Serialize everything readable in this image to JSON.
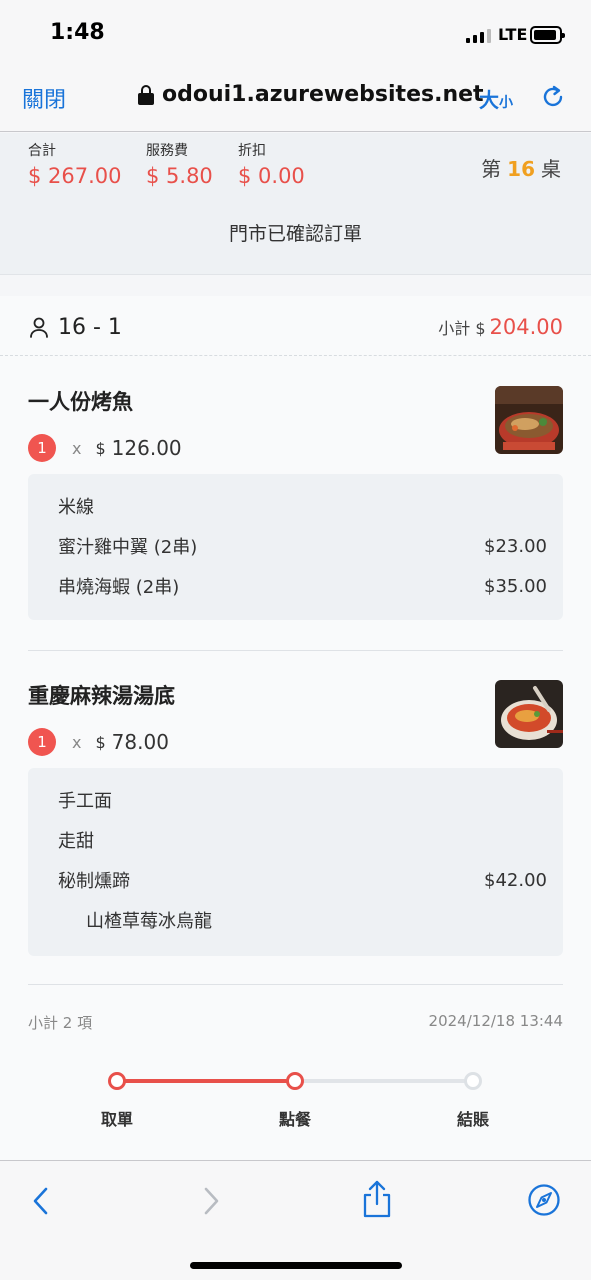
{
  "status_bar": {
    "time": "1:48",
    "network": "LTE"
  },
  "nav": {
    "close_label": "關閉",
    "url": "odoui1.azurewebsites.net",
    "size_big": "大",
    "size_small": "小"
  },
  "summary": {
    "total_label": "合計",
    "total_value": "$ 267.00",
    "service_label": "服務費",
    "service_value": "$ 5.80",
    "discount_label": "折扣",
    "discount_value": "$ 0.00",
    "table_prefix": "第",
    "table_number": "16",
    "table_suffix": "桌",
    "status_text": "門市已確認訂單"
  },
  "guest": {
    "label": "16 - 1",
    "subtotal_label": "小計 $",
    "subtotal_value": "204.00"
  },
  "items": [
    {
      "name": "一人份烤魚",
      "qty": "1",
      "x": "x",
      "currency": "$",
      "price": "126.00",
      "options": [
        {
          "name": "米線",
          "price": ""
        },
        {
          "name": "蜜汁雞中翼 (2串)",
          "price": "$23.00"
        },
        {
          "name": "串燒海蝦 (2串)",
          "price": "$35.00"
        }
      ]
    },
    {
      "name": "重慶麻辣湯湯底",
      "qty": "1",
      "x": "x",
      "currency": "$",
      "price": "78.00",
      "options": [
        {
          "name": "手工面",
          "price": ""
        },
        {
          "name": "走甜",
          "price": ""
        },
        {
          "name": "秘制燻蹄",
          "price": "$42.00"
        },
        {
          "name": "山楂草莓冰烏龍",
          "price": ""
        }
      ]
    }
  ],
  "footer": {
    "count_text": "小計 2 項",
    "timestamp": "2024/12/18 13:44"
  },
  "progress": {
    "steps": [
      "取單",
      "點餐",
      "結賬"
    ],
    "current_step": 2
  },
  "colors": {
    "accent_red": "#e8504a",
    "link_blue": "#1a74d9",
    "table_orange": "#f0a020"
  }
}
